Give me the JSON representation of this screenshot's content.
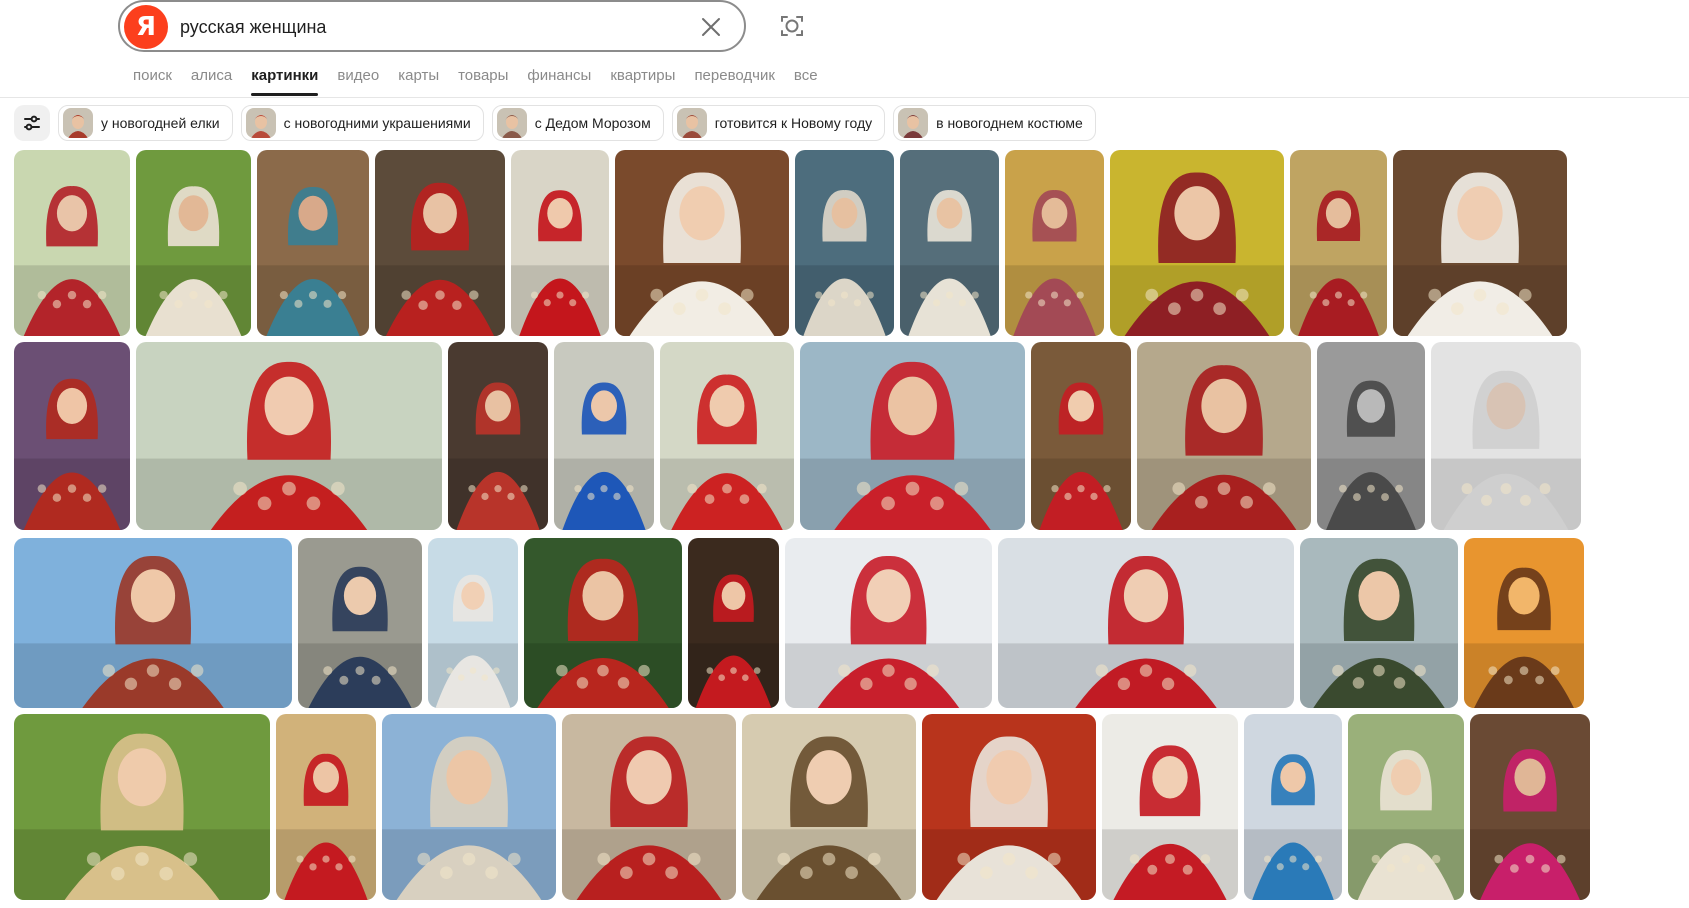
{
  "search": {
    "logo_letter": "Я",
    "query": "русская женщина"
  },
  "services": [
    "поиск",
    "алиса",
    "картинки",
    "видео",
    "карты",
    "товары",
    "финансы",
    "квартиры",
    "переводчик",
    "все"
  ],
  "active_service_index": 2,
  "chips": [
    {
      "label": "у новогодней елки"
    },
    {
      "label": "с новогодними украшениями"
    },
    {
      "label": "с Дедом Морозом"
    },
    {
      "label": "готовится к Новому году"
    },
    {
      "label": "в новогоднем костюме"
    }
  ],
  "colors": {
    "brand_red": "#fc3f1d",
    "active_text": "#1f1f1f",
    "inactive_text": "#8a8a8a"
  },
  "image_results": {
    "row1": [
      {
        "bg": "#c9d7b0",
        "accent": "#b3242a",
        "skin": "#e9c4a8"
      },
      {
        "bg": "#6f9a3e",
        "accent": "#e8e0d0",
        "skin": "#e2b896"
      },
      {
        "bg": "#8b6a4a",
        "accent": "#3a7f92",
        "skin": "#d8a98a"
      },
      {
        "bg": "#5c4b3a",
        "accent": "#b8211f",
        "skin": "#e8c2a4"
      },
      {
        "bg": "#d9d5c7",
        "accent": "#c4161c",
        "skin": "#efc9ac"
      },
      {
        "bg": "#7a4a2c",
        "accent": "#f2ede4",
        "skin": "#f0cdb0"
      },
      {
        "bg": "#4d6d7d",
        "accent": "#dcd6c8",
        "skin": "#e6c0a0"
      },
      {
        "bg": "#556e7a",
        "accent": "#e7e2d6",
        "skin": "#e8c3a3"
      },
      {
        "bg": "#c9a24a",
        "accent": "#a34a55",
        "skin": "#e4bb98"
      },
      {
        "bg": "#c9b52f",
        "accent": "#8e1f24",
        "skin": "#ecc6a7"
      },
      {
        "bg": "#bfa462",
        "accent": "#a81c22",
        "skin": "#e5bd9c"
      },
      {
        "bg": "#6b4a30",
        "accent": "#f1ede6",
        "skin": "#efcdb2"
      }
    ],
    "row2": [
      {
        "bg": "#6b4f74",
        "accent": "#b02a20",
        "skin": "#efc5a6"
      },
      {
        "bg": "#c8d3c0",
        "accent": "#c41f1f",
        "skin": "#f0cbb0"
      },
      {
        "bg": "#4a3a30",
        "accent": "#b8342a",
        "skin": "#e8c1a2"
      },
      {
        "bg": "#c8c9bf",
        "accent": "#1e57b8",
        "skin": "#ecc7aa"
      },
      {
        "bg": "#d4d8c6",
        "accent": "#cc2222",
        "skin": "#efcbae"
      },
      {
        "bg": "#9cb7c6",
        "accent": "#c9202a",
        "skin": "#ebc3a3"
      },
      {
        "bg": "#7a5a3a",
        "accent": "#c21e24",
        "skin": "#f0ccae"
      },
      {
        "bg": "#b5a88c",
        "accent": "#a8201f",
        "skin": "#e9c2a2"
      },
      {
        "bg": "#9a9a9a",
        "accent": "#4a4a4a",
        "skin": "#b9b9b9"
      },
      {
        "bg": "#e3e3e3",
        "accent": "#cfcfcf",
        "skin": "#d8c3b4"
      }
    ],
    "row3": [
      {
        "bg": "#7fb1dc",
        "accent": "#9a3a2a",
        "skin": "#efc8a8"
      },
      {
        "bg": "#9a9a90",
        "accent": "#2c3d5a",
        "skin": "#eccaad"
      },
      {
        "bg": "#c7dbe6",
        "accent": "#e8e6e2",
        "skin": "#f1d0b5"
      },
      {
        "bg": "#34582c",
        "accent": "#b8261e",
        "skin": "#ebc4a4"
      },
      {
        "bg": "#3b2a1e",
        "accent": "#c41a1f",
        "skin": "#eec6a7"
      },
      {
        "bg": "#e9ecef",
        "accent": "#c81f2c",
        "skin": "#f1cfb6"
      },
      {
        "bg": "#d9dfe4",
        "accent": "#c11b24",
        "skin": "#efcdb3"
      },
      {
        "bg": "#a9b9bd",
        "accent": "#3a4a2f",
        "skin": "#ecc7a8"
      },
      {
        "bg": "#e8952f",
        "accent": "#6a3a1a",
        "skin": "#f2b66a"
      }
    ],
    "row4": [
      {
        "bg": "#6f9a3e",
        "accent": "#d8c08a",
        "skin": "#efcbab"
      },
      {
        "bg": "#d1b27a",
        "accent": "#c41a20",
        "skin": "#edc5a5"
      },
      {
        "bg": "#8cb2d6",
        "accent": "#d8d0c0",
        "skin": "#ecc6a6"
      },
      {
        "bg": "#c8b8a0",
        "accent": "#b8201f",
        "skin": "#efcab0"
      },
      {
        "bg": "#d6cbb0",
        "accent": "#6a5030",
        "skin": "#efcdb1"
      },
      {
        "bg": "#b8341c",
        "accent": "#e8e2d8",
        "skin": "#f0cbaf"
      },
      {
        "bg": "#ecebe6",
        "accent": "#c41b24",
        "skin": "#f1cfb4"
      },
      {
        "bg": "#cfd7e0",
        "accent": "#2a7ab8",
        "skin": "#eec8a9"
      },
      {
        "bg": "#9ab07a",
        "accent": "#e9e2d2",
        "skin": "#efcdb0"
      },
      {
        "bg": "#6a4a34",
        "accent": "#c81f6a",
        "skin": "#e0b696"
      }
    ]
  }
}
